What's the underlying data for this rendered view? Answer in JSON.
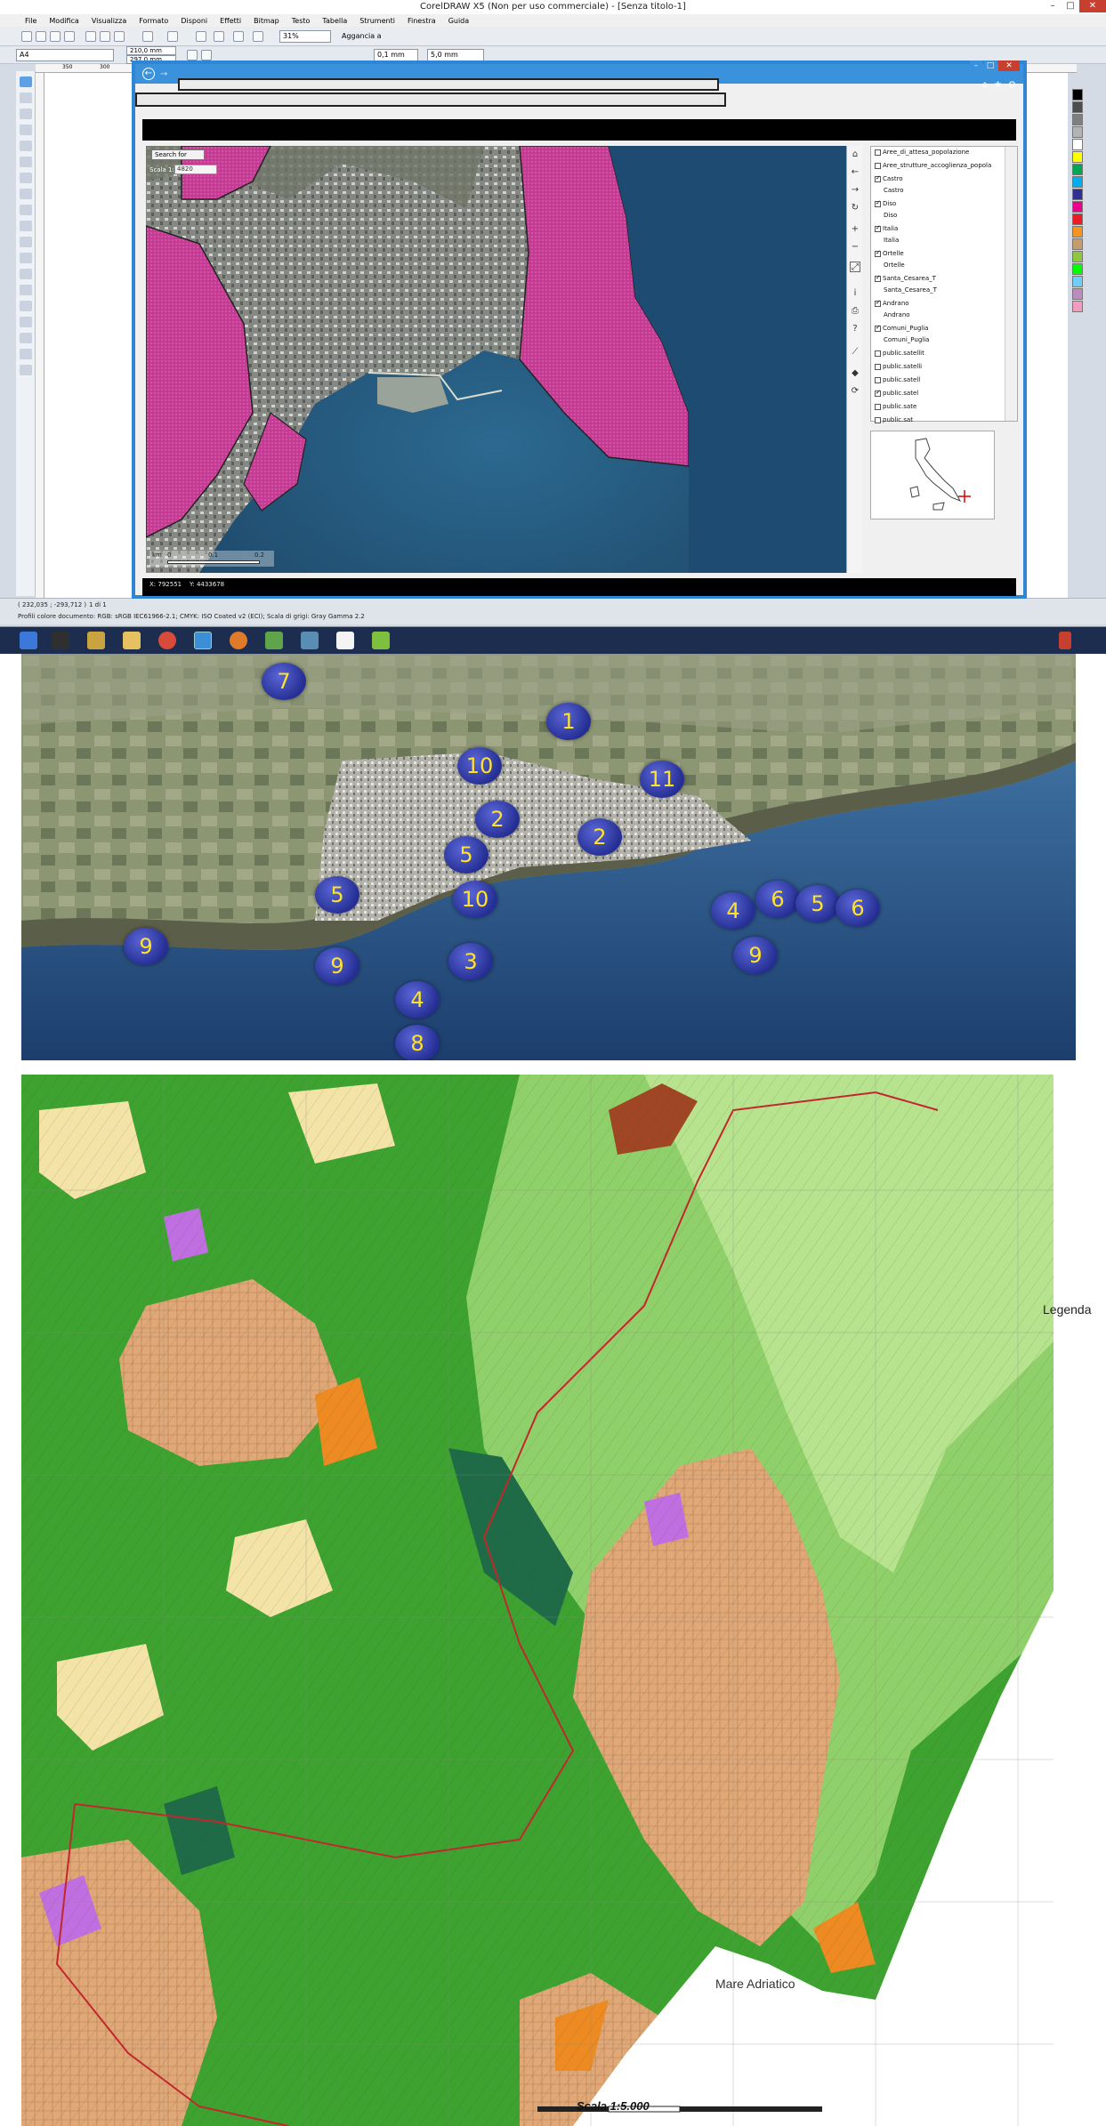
{
  "app": {
    "title": "CorelDRAW X5 (Non per uso commerciale) - [Senza titolo-1]",
    "menu": [
      "File",
      "Modifica",
      "Visualizza",
      "Formato",
      "Disponi",
      "Effetti",
      "Bitmap",
      "Testo",
      "Tabella",
      "Strumenti",
      "Finestra",
      "Guida"
    ],
    "toolbar": {
      "zoom": "31%",
      "snap_label": "Aggancia a",
      "page_size": "A4",
      "width": "210,0 mm",
      "height": "297,0 mm",
      "nudge": "5,0 mm",
      "nudge2": "0,1 mm"
    },
    "ruler_marks": [
      "350",
      "300"
    ],
    "status": {
      "coords": "( 232,035 ; -293,712 )",
      "page": "1 di 1",
      "profile": "Profili colore documento: RGB: sRGB IEC61966-2.1; CMYK: ISO Coated v2 (ECI); Scala di grigi: Gray Gamma 2.2"
    },
    "palette": [
      "#000000",
      "#4d4d4d",
      "#7f7f7f",
      "#b3b3b3",
      "#ffffff",
      "#ffff00",
      "#00a651",
      "#00aeef",
      "#2e3192",
      "#ec008c",
      "#ed1c24",
      "#f7941d",
      "#c69c6d",
      "#8dc63f",
      "#00ff00",
      "#6dcff6",
      "#bd8cbf",
      "#f49ac1"
    ]
  },
  "browser": {
    "search_label": "Search for",
    "scale_label": "Scala 1:",
    "scale_value": "4820",
    "scalebar": {
      "unit": "km",
      "ticks": [
        "0",
        "0.1",
        "0.2"
      ]
    },
    "coords": {
      "x": "X: 792551",
      "y": "Y: 4433678"
    },
    "layers": [
      {
        "label": "Aree_di_attesa_popolazione",
        "checked": false
      },
      {
        "label": "Aree_strutture_accoglienza_popola",
        "checked": false
      },
      {
        "label": "Castro",
        "checked": true,
        "sub": "Castro"
      },
      {
        "label": "Diso",
        "checked": true,
        "sub": "Diso"
      },
      {
        "label": "Italia",
        "checked": true,
        "sub": "Italia"
      },
      {
        "label": "Ortelle",
        "checked": true,
        "sub": "Ortelle"
      },
      {
        "label": "Santa_Cesarea_T",
        "checked": true,
        "sub": "Santa_Cesarea_T"
      },
      {
        "label": "Andrano",
        "checked": true,
        "sub": "Andrano"
      },
      {
        "label": "Comuni_Puglia",
        "checked": true,
        "sub": "Comuni_Puglia"
      },
      {
        "label": "public.satellit",
        "checked": false
      },
      {
        "label": "public.satelli",
        "checked": false
      },
      {
        "label": "public.satell",
        "checked": false
      },
      {
        "label": "public.satel",
        "checked": true
      },
      {
        "label": "public.sate",
        "checked": false
      },
      {
        "label": "public.sat",
        "checked": false
      }
    ],
    "map_tools": [
      "home-icon",
      "back-icon",
      "forward-icon",
      "refresh-icon",
      "zoom-in-icon",
      "zoom-out-icon",
      "extent-icon",
      "info-icon",
      "print-icon",
      "help-icon",
      "measure-icon",
      "fill-icon",
      "reload-icon"
    ]
  },
  "taskbar": {
    "apps": [
      "windows-start",
      "app-corel",
      "app-explorer",
      "app-files",
      "app-chrome",
      "app-ie",
      "app-firefox",
      "app-corel-draw",
      "app-corel-photo",
      "app-docs",
      "app-generic"
    ]
  },
  "aerial_points": [
    {
      "label": "7"
    },
    {
      "label": "1"
    },
    {
      "label": "10"
    },
    {
      "label": "11"
    },
    {
      "label": "2"
    },
    {
      "label": "2"
    },
    {
      "label": "5"
    },
    {
      "label": "5"
    },
    {
      "label": "10"
    },
    {
      "label": "4"
    },
    {
      "label": "6"
    },
    {
      "label": "5"
    },
    {
      "label": "6"
    },
    {
      "label": "9"
    },
    {
      "label": "9"
    },
    {
      "label": "3"
    },
    {
      "label": "9"
    },
    {
      "label": "4"
    },
    {
      "label": "8"
    }
  ],
  "landmap": {
    "legend": "Legenda",
    "sea": "Mare Adriatico",
    "scale": "Scala 1:5.000"
  }
}
